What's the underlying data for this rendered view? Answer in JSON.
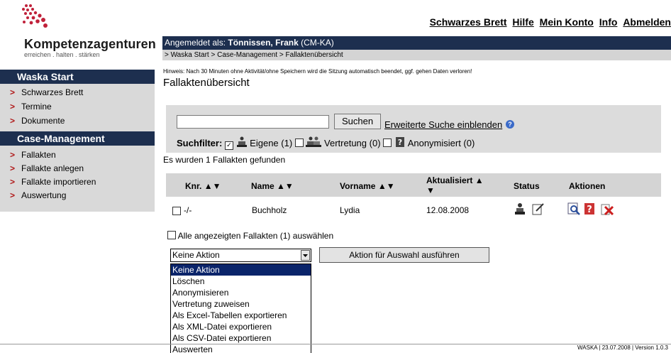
{
  "brand": {
    "name": "Kompetenzagenturen",
    "slogan": "erreichen . halten . stärken"
  },
  "toplinks": [
    "Schwarzes Brett",
    "Hilfe",
    "Mein Konto",
    "Info",
    "Abmelden"
  ],
  "header": {
    "login_prefix": "Angemeldet als: ",
    "user": "Tönnissen, Frank",
    "user_suffix": " (CM-KA)",
    "breadcrumb": "> Waska Start > Case-Management > Fallaktenübersicht"
  },
  "sidebar": {
    "section1": "Waska Start",
    "items1": [
      "Schwarzes Brett",
      "Termine",
      "Dokumente"
    ],
    "section2": "Case-Management",
    "items2": [
      "Fallakten",
      "Fallakte anlegen",
      "Fallakte importieren",
      "Auswertung"
    ]
  },
  "main": {
    "hint": "Hinweis: Nach 30 Minuten ohne Aktivität/ohne Speichern wird die Sitzung automatisch beendet, ggf. gehen Daten verloren!",
    "title": "Fallaktenübersicht",
    "search_value": "",
    "search_button": "Suchen",
    "advanced_link": "Erweiterte Suche einblenden",
    "filter_label": "Suchfilter:",
    "filters": [
      {
        "label": "Eigene (1)",
        "checked": true
      },
      {
        "label": "Vertretung (0)",
        "checked": false
      },
      {
        "label": "Anonymisiert (0)",
        "checked": false
      }
    ],
    "found_text": "Es wurden 1 Fallakten gefunden",
    "columns": {
      "knr": "Knr.",
      "name": "Name",
      "vorname": "Vorname",
      "aktualisiert": "Aktualisiert",
      "status": "Status",
      "aktionen": "Aktionen"
    },
    "rows": [
      {
        "knr": "-/-",
        "name": "Buchholz",
        "vorname": "Lydia",
        "aktualisiert": "12.08.2008"
      }
    ],
    "select_all": "Alle angezeigten Fallakten (1) auswählen",
    "action_selected": "Keine Aktion",
    "action_button": "Aktion für Auswahl ausführen",
    "action_options": [
      "Keine Aktion",
      "Löschen",
      "Anonymisieren",
      "Vertretung zuweisen",
      "Als Excel-Tabellen exportieren",
      "Als XML-Datei exportieren",
      "Als CSV-Datei exportieren",
      "Auswerten"
    ]
  },
  "footer": "WASKA | 23.07.2008 | Version 1.0.3",
  "colors": {
    "navy": "#1d2f4f",
    "arrow_red": "#b01818",
    "selected_option": "#0a246a"
  }
}
